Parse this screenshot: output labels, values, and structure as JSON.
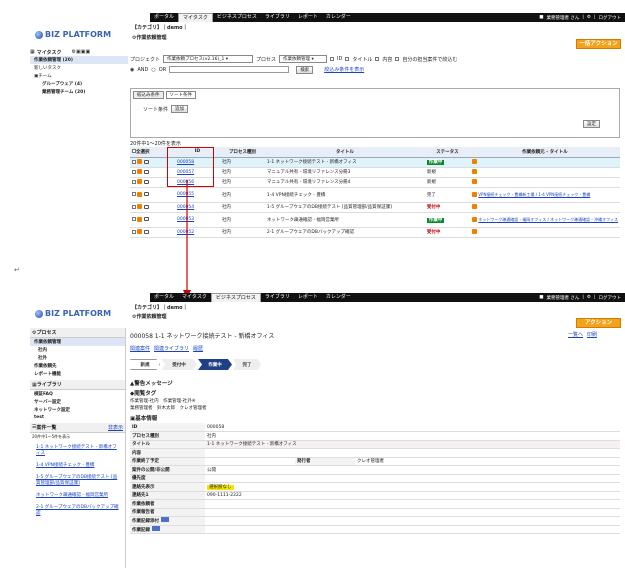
{
  "top": {
    "tabs": [
      "ポータル",
      "マイタスク",
      "ビジネスプロセス",
      "ライブラリ",
      "レポート",
      "カレンダー"
    ],
    "active_tab": "マイタスク",
    "user": "業務管理者 さん",
    "separator": "|",
    "logout": "ログアウト",
    "brand": "BIZ PLATFORM",
    "category": "【カテゴリ】｜demo｜",
    "page_title": "作業依頼管理",
    "bulk_action": "一括アクション"
  },
  "sidebar": {
    "header": "マイタスク",
    "items": [
      "作業依頼管理 (20)",
      "新しいタスク"
    ],
    "team_label": "チーム",
    "team_items": [
      "グループウェア (4)",
      "業務管理チーム (20)"
    ]
  },
  "search": {
    "project_label": "プロジェクト",
    "project_value": "作業依頼プロセス(v2.16)_1",
    "process_label": "プロセス",
    "process_value": "作業依頼管理",
    "checks": [
      "ID",
      "タイトル",
      "内容",
      "自分の担当案件で絞込む"
    ],
    "and_label": "AND",
    "or_label": "OR",
    "search_btn": "検索",
    "detail_link": "絞込み条件を表示"
  },
  "sort_tabs": [
    "絞込み条件",
    "ソート条件"
  ],
  "sort_condition_label": "ソート条件",
  "add_btn": "追加",
  "apply_btn": "設定",
  "result_count": "20件中1～20件を表示",
  "table": {
    "headers": [
      "全選択",
      "ID",
      "プロセス種別",
      "タイトル",
      "ステータス",
      "作業依頼元 - タイトル"
    ],
    "rows": [
      {
        "id": "000058",
        "type": "社内",
        "title": "1-1 ネットワーク接続テスト - 新橋オフィス",
        "status": "作業中",
        "parent": ""
      },
      {
        "id": "000057",
        "type": "社内",
        "title": "マニュアル共有 - 環境リファレンス分冊3",
        "status": "新規",
        "parent": ""
      },
      {
        "id": "000056",
        "type": "社内",
        "title": "マニュアル共有 - 環境リファレンス分冊4",
        "status": "新規",
        "parent": ""
      },
      {
        "id": "000055",
        "type": "社内",
        "title": "1-4 VPN接続チェック - 豊橋",
        "status": "完了",
        "parent": "VPN接続チェック - 豊橋新工場 / 1-4 VPN接続チェック - 豊橋"
      },
      {
        "id": "000054",
        "type": "社内",
        "title": "1-5 グループウェアのDB接続テスト [品質管理部/品質保証課]",
        "status": "受付中",
        "parent": ""
      },
      {
        "id": "000053",
        "type": "社内",
        "title": "ネットワーク疎通確認 - 福岡営業所",
        "status": "作業中",
        "parent": "ネットワーク疎通確認 - 福岡オフィス / ネットワーク疎通確認 - 沖縄オフィス"
      },
      {
        "id": "000052",
        "type": "社内",
        "title": "2-1 グループウェアのDBバックアップ確認",
        "status": "受付中",
        "parent": ""
      }
    ]
  },
  "bottom": {
    "active_tab": "ビジネスプロセス",
    "action_btn": "アクション",
    "item_title": "000058 1-1 ネットワーク接続テスト - 新橋オフィス",
    "nav_links": [
      "一覧へ",
      "印刷"
    ],
    "sublinks": [
      "関連案件",
      "関連ライブラリ",
      "履歴"
    ],
    "steps": [
      "新規",
      "受付中",
      "作業中",
      "完了"
    ],
    "active_step": "作業中",
    "alert_title": "警告メッセージ",
    "notice_tag": "閲覧タグ",
    "notice_lines": [
      "作業管理-社内　作業管理-社外※",
      "業務管理者　鈴木太郎　クレオ管理者"
    ],
    "basic_info": "基本情報",
    "side": {
      "process_header": "プロセス",
      "process_items": [
        "作業依頼管理",
        "社内",
        "社外",
        "作業依頼先",
        "レポート機能"
      ],
      "library_header": "ライブラリ",
      "library_items": [
        "検証FAQ",
        "サーバー設定",
        "ネットワーク設定",
        "test"
      ],
      "list_header": "案件一覧",
      "list_toggle": "非表示",
      "list_count": "20件中1～5件を表示",
      "list_items": [
        "1-1 ネットワーク接続テスト - 新橋オフィス",
        "1-4 VPN接続チェック - 豊橋",
        "1-5 グループウェアのDB接続テスト [品質管理部/品質保証課]",
        "ネットワーク疎通確認 - 福岡営業所",
        "2-1 グループウェアのDBバックアップ確認"
      ]
    },
    "fields": [
      {
        "k": "ID",
        "v": "000058"
      },
      {
        "k": "プロセス種別",
        "v": "社内"
      },
      {
        "k": "タイトル",
        "v": "1-1 ネットワーク接続テスト - 新橋オフィス"
      },
      {
        "k": "内容",
        "v": ""
      },
      {
        "k": "作業終了予定",
        "v": "",
        "k2": "発行者",
        "v2": "クレオ管理者"
      },
      {
        "k": "案件の公開/非公開",
        "v": "公開"
      },
      {
        "k": "優先度",
        "v": ""
      },
      {
        "k": "連絡先表示",
        "v": "選択肢なし"
      },
      {
        "k": "連絡先1",
        "v": "090-1111-2222"
      },
      {
        "k": "作業依頼者",
        "v": ""
      },
      {
        "k": "作業報告者",
        "v": ""
      },
      {
        "k": "作業記録添付",
        "v": ""
      },
      {
        "k": "作業記録",
        "v": ""
      }
    ]
  },
  "colors": {
    "brand": "#3a62b5",
    "orange": "#f4a21b",
    "active_green": "#0a8a2a",
    "link": "#1a44c4",
    "step_active": "#1f3f86"
  }
}
